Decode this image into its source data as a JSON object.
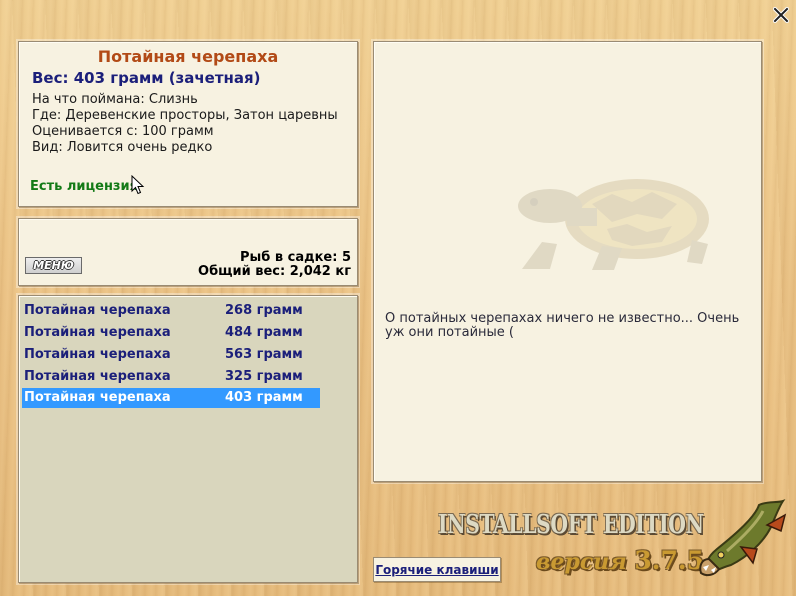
{
  "window": {
    "close_icon": "close-x-icon"
  },
  "fish_info": {
    "name": "Потайная черепаха",
    "weight": "Вес: 403 грамм (зачетная)",
    "bait": "На что поймана: Слизнь",
    "location": "Где: Деревенские просторы, Затон царевны",
    "rated_from": "Оценивается с: 100 грамм",
    "rarity": "Вид: Ловится очень редко",
    "license": "Есть лицензия"
  },
  "keepnet": {
    "menu_label": "МЕНЮ",
    "fish_count": "Рыб в садке: 5",
    "total_weight": "Общий вес: 2,042 кг"
  },
  "catch_list": [
    {
      "name": "Потайная черепаха",
      "weight": "268 грамм",
      "selected": false
    },
    {
      "name": "Потайная черепаха",
      "weight": "484 грамм",
      "selected": false
    },
    {
      "name": "Потайная черепаха",
      "weight": "563 грамм",
      "selected": false
    },
    {
      "name": "Потайная черепаха",
      "weight": "325 грамм",
      "selected": false
    },
    {
      "name": "Потайная черепаха",
      "weight": "403 грамм",
      "selected": true
    }
  ],
  "description": {
    "image": "turtle-image",
    "text": "О потайных черепахах ничего не известно... Очень уж они потайные ("
  },
  "footer": {
    "hotkeys_label": "Горячие клавиши",
    "edition": "INSTALLSOFT EDITION",
    "version_prefix": "версия",
    "version_number": "3.7.5"
  },
  "colors": {
    "title": "#b24a16",
    "weight_text": "#1b1f7a",
    "license_text": "#137a16",
    "selected_row": "#3399ff",
    "panel_bg": "#f7f2e1",
    "list_bg": "#d9d6bd"
  }
}
